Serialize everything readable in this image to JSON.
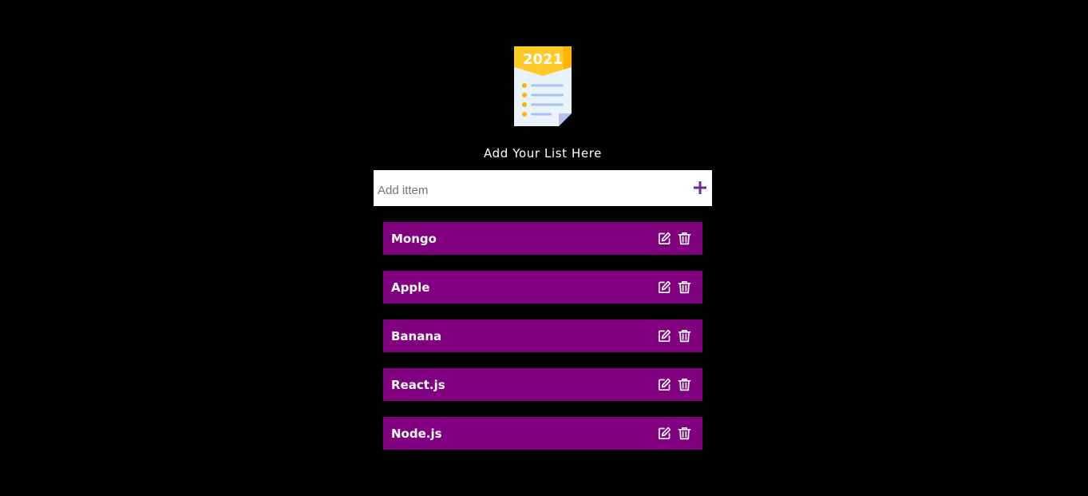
{
  "logo": {
    "year_text": "2021",
    "icon": "list-document-icon"
  },
  "header": {
    "subtitle": "Add Your List Here"
  },
  "add_item": {
    "placeholder": "Add ittem",
    "value": "",
    "button_icon": "plus-icon"
  },
  "items": [
    {
      "label": "Mongo"
    },
    {
      "label": "Apple"
    },
    {
      "label": "Banana"
    },
    {
      "label": "React.js"
    },
    {
      "label": "Node.js"
    }
  ],
  "item_actions": {
    "edit_icon": "edit-icon",
    "delete_icon": "trash-icon"
  },
  "colors": {
    "background": "#000000",
    "item_background": "#800080",
    "item_text": "#ffffff",
    "accent": "#6a2c91",
    "logo_yellow": "#ffca28",
    "logo_paper": "#eaf2fb",
    "logo_lines": "#a9bfef"
  }
}
